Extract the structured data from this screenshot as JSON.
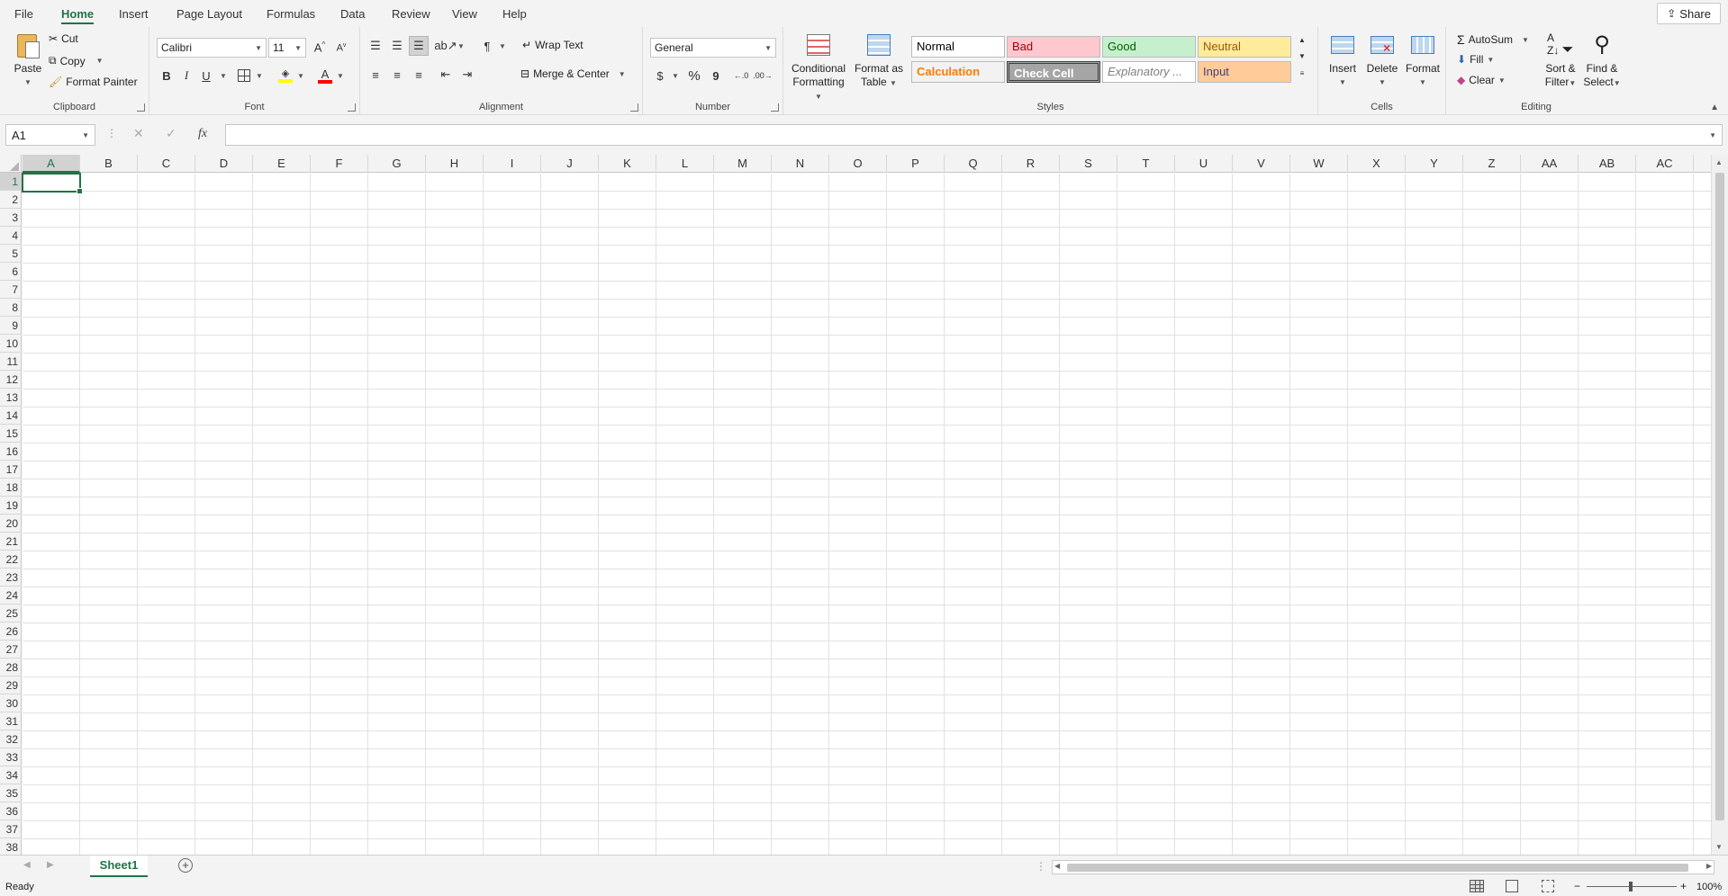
{
  "menu": {
    "tabs": [
      "File",
      "Home",
      "Insert",
      "Page Layout",
      "Formulas",
      "Data",
      "Review",
      "View",
      "Help"
    ],
    "active": "Home",
    "share_label": "Share"
  },
  "clipboard": {
    "paste": "Paste",
    "cut": "Cut",
    "copy": "Copy",
    "format_painter": "Format Painter",
    "label": "Clipboard"
  },
  "font": {
    "name": "Calibri",
    "size": "11",
    "label": "Font",
    "bold": "B",
    "italic": "I",
    "underline": "U"
  },
  "alignment": {
    "wrap_text": "Wrap Text",
    "merge_center": "Merge & Center",
    "label": "Alignment"
  },
  "number": {
    "format": "General",
    "currency": "$",
    "percent": "%",
    "comma": "9",
    "label": "Number"
  },
  "styles": {
    "conditional_formatting": [
      "Conditional",
      "Formatting"
    ],
    "format_as_table": [
      "Format as",
      "Table"
    ],
    "cells": [
      {
        "label": "Normal",
        "bg": "#ffffff",
        "color": "#000000"
      },
      {
        "label": "Bad",
        "bg": "#ffc7ce",
        "color": "#9c0006"
      },
      {
        "label": "Good",
        "bg": "#c6efce",
        "color": "#006100"
      },
      {
        "label": "Neutral",
        "bg": "#ffeb9c",
        "color": "#9c5700"
      },
      {
        "label": "Calculation",
        "bg": "#f2f2f2",
        "color": "#fa7d00"
      },
      {
        "label": "Check Cell",
        "bg": "#a5a5a5",
        "color": "#ffffff"
      },
      {
        "label": "Explanatory ...",
        "bg": "#ffffff",
        "color": "#7f7f7f"
      },
      {
        "label": "Input",
        "bg": "#ffcc99",
        "color": "#3f3f76"
      }
    ],
    "label": "Styles"
  },
  "cells_group": {
    "insert": "Insert",
    "delete": "Delete",
    "format": "Format",
    "label": "Cells"
  },
  "editing": {
    "autosum": "AutoSum",
    "fill": "Fill",
    "clear": "Clear",
    "sort_filter": [
      "Sort &",
      "Filter"
    ],
    "find_select": [
      "Find &",
      "Select"
    ],
    "label": "Editing"
  },
  "formula_bar": {
    "name_box": "A1",
    "fx": "fx",
    "value": ""
  },
  "grid": {
    "columns": [
      "A",
      "B",
      "C",
      "D",
      "E",
      "F",
      "G",
      "H",
      "I",
      "J",
      "K",
      "L",
      "M",
      "N",
      "O",
      "P",
      "Q",
      "R",
      "S",
      "T",
      "U",
      "V",
      "W",
      "X",
      "Y",
      "Z",
      "AA",
      "AB",
      "AC"
    ],
    "row_count": 38,
    "selected_col": "A",
    "selected_row": 1
  },
  "sheets": [
    "Sheet1"
  ],
  "status": {
    "ready": "Ready",
    "zoom": "100%"
  }
}
